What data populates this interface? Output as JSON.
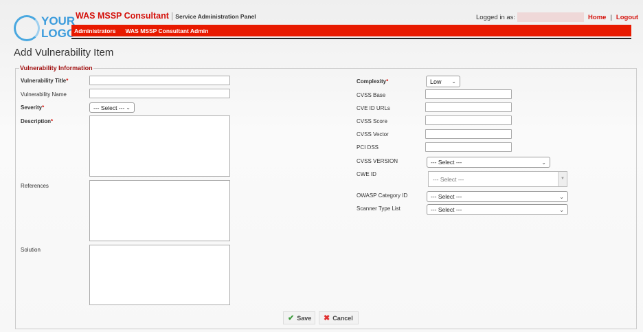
{
  "header": {
    "logo_line1": "YOUR",
    "logo_line2": "LOGO",
    "app_name": "WAS MSSP Consultant",
    "separator": "|",
    "subtitle": "Service Administration Panel",
    "logged_in_label": "Logged in as:",
    "home": "Home",
    "link_sep": "|",
    "logout": "Logout"
  },
  "nav": {
    "items": [
      "Administrators",
      "WAS MSSP Consultant Admin"
    ]
  },
  "page": {
    "title": "Add Vulnerability Item",
    "legend": "Vulnerability Information"
  },
  "left": {
    "title_label": "Vulnerability Title",
    "name_label": "Vulnerability Name",
    "severity_label": "Severity",
    "severity_value": "--- Select ---",
    "description_label": "Description",
    "references_label": "References",
    "solution_label": "Solution",
    "required": "*"
  },
  "right": {
    "complexity_label": "Complexity",
    "complexity_value": "Low",
    "cvss_base": "CVSS Base",
    "cve_urls": "CVE ID URLs",
    "cvss_score": "CVSS Score",
    "cvss_vector": "CVSS Vector",
    "pci_dss": "PCI DSS",
    "cvss_version": "CVSS VERSION",
    "cvss_version_value": "--- Select ---",
    "cwe_id": "CWE ID",
    "cwe_value": "--- Select ---",
    "owasp": "OWASP Category ID",
    "owasp_value": "--- Select ---",
    "scanner": "Scanner Type List",
    "scanner_value": "--- Select ---"
  },
  "buttons": {
    "save": "Save",
    "cancel": "Cancel"
  }
}
